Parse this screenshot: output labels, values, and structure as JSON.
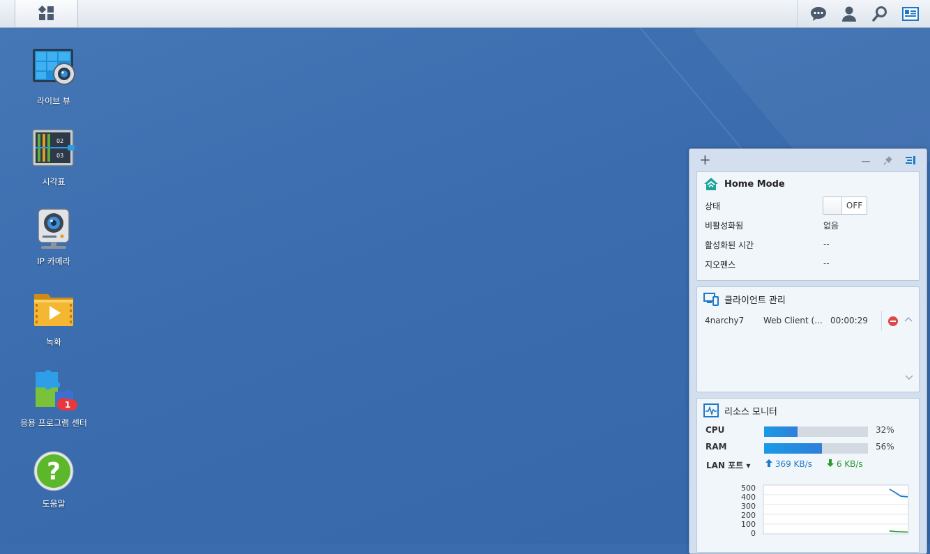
{
  "taskbar": {
    "main_menu": "main-menu",
    "tray_icons": [
      "chat-icon",
      "user-icon",
      "search-icon",
      "widgets-icon"
    ]
  },
  "desktop": {
    "shortcuts": [
      {
        "label": "라이브 뷰",
        "icon": "live-view-icon"
      },
      {
        "label": "시각표",
        "icon": "timeline-icon"
      },
      {
        "label": "IP 카메라",
        "icon": "ip-camera-icon"
      },
      {
        "label": "녹화",
        "icon": "recording-icon"
      },
      {
        "label": "응용 프로그램 센터",
        "icon": "package-center-icon",
        "badge": "1"
      },
      {
        "label": "도움말",
        "icon": "help-icon"
      }
    ]
  },
  "widgets": {
    "add_label": "+",
    "home_mode": {
      "title": "Home Mode",
      "rows": [
        {
          "key": "상태",
          "value": "OFF"
        },
        {
          "key": "비활성화됨",
          "value": "없음"
        },
        {
          "key": "활성화된 시간",
          "value": "--"
        },
        {
          "key": "지오펜스",
          "value": "--"
        }
      ]
    },
    "client_mgmt": {
      "title": "클라이언트 관리",
      "clients": [
        {
          "user": "4narchy7",
          "client": "Web Client (...",
          "duration": "00:00:29"
        }
      ]
    },
    "resource_monitor": {
      "title": "리소스 모니터",
      "cpu": {
        "label": "CPU",
        "value": "32%",
        "fraction": 0.32
      },
      "ram": {
        "label": "RAM",
        "value": "56%",
        "fraction": 0.56
      },
      "lan": {
        "label": "LAN 포트 ▾",
        "upload": "369 KB/s",
        "download": "6 KB/s"
      },
      "chart_axis": [
        "500",
        "400",
        "300",
        "200",
        "100",
        "0"
      ]
    }
  },
  "colors": {
    "desktop_bg": "#3a6cae",
    "accent_blue": "#1f7ac9",
    "download_green": "#2a9a2a",
    "badge_red": "#e8383d"
  }
}
